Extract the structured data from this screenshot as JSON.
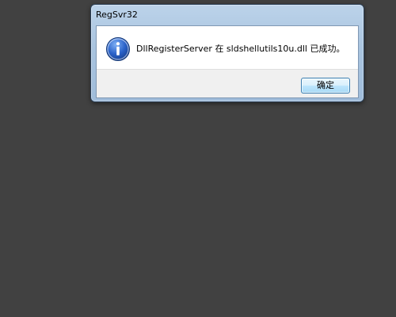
{
  "window": {
    "title": "RegSvr32"
  },
  "message": {
    "icon": "info-icon",
    "text": "DllRegisterServer 在 sldshellutils10u.dll 已成功。"
  },
  "buttons": {
    "ok_label": "确定"
  },
  "colors": {
    "desktop_background": "#414141",
    "frame": "#a9c4df",
    "icon_blue": "#2a62c9",
    "button_border": "#3c7fb1"
  }
}
